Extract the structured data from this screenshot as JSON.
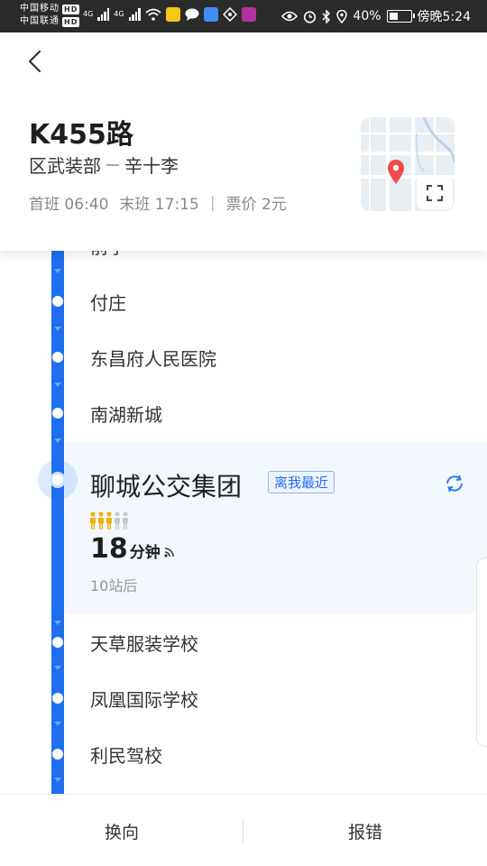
{
  "status_bar": {
    "carrier1": "中国移动",
    "carrier2": "中国联通",
    "hd": "HD",
    "net1": "4G",
    "net2": "4G",
    "battery": "40%",
    "battery_level": 0.4,
    "time": "傍晚5:24"
  },
  "route": {
    "name": "K455路",
    "from": "区武装部",
    "to": "辛十李",
    "first_bus": "首班 06:40",
    "last_bus": "末班 17:15",
    "fare": "票价 2元"
  },
  "stops_before": [
    {
      "name": "付庄"
    },
    {
      "name": "东昌府人民医院"
    },
    {
      "name": "南湖新城"
    }
  ],
  "partial_stop": {
    "name": "前李"
  },
  "current_stop": {
    "name": "聊城公交集团",
    "badge": "离我最近",
    "eta_value": "18",
    "eta_unit": "分钟",
    "stops_away": "10站后",
    "crowd_level": 3,
    "crowd_max": 5
  },
  "stops_after": [
    {
      "name": "天草服装学校"
    },
    {
      "name": "凤凰国际学校"
    },
    {
      "name": "利民驾校"
    }
  ],
  "bottom_bar": {
    "switch_direction": "换向",
    "report_error": "报错"
  },
  "colors": {
    "accent": "#1e6ef0",
    "crowd_active": "#f2b20a",
    "crowd_inactive": "#c8c8c8",
    "map_pin": "#f04a4a"
  }
}
